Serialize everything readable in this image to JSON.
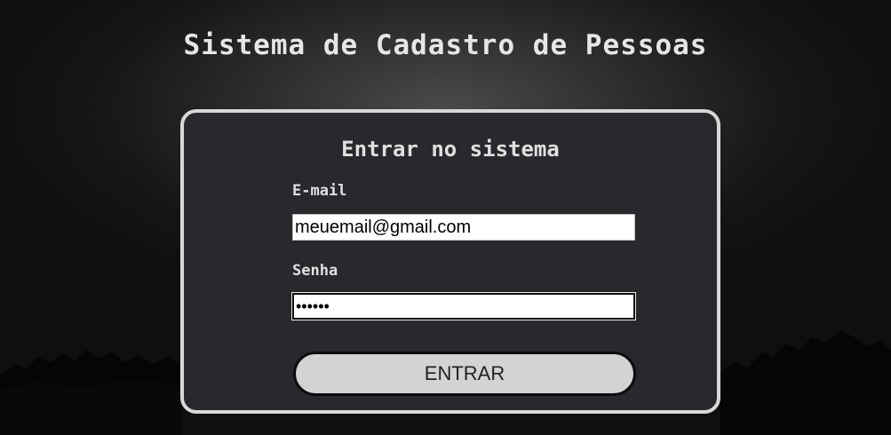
{
  "page": {
    "title": "Sistema de Cadastro de Pessoas"
  },
  "login": {
    "heading": "Entrar no sistema",
    "email_label": "E-mail",
    "email_value": "meuemail@gmail.com",
    "password_label": "Senha",
    "password_value": "123456",
    "submit_label": "ENTRAR"
  },
  "colors": {
    "card_background": "#29282d",
    "card_border": "#d8d8d8",
    "button_background": "#d3d3d5",
    "text": "#e0e0e0"
  }
}
